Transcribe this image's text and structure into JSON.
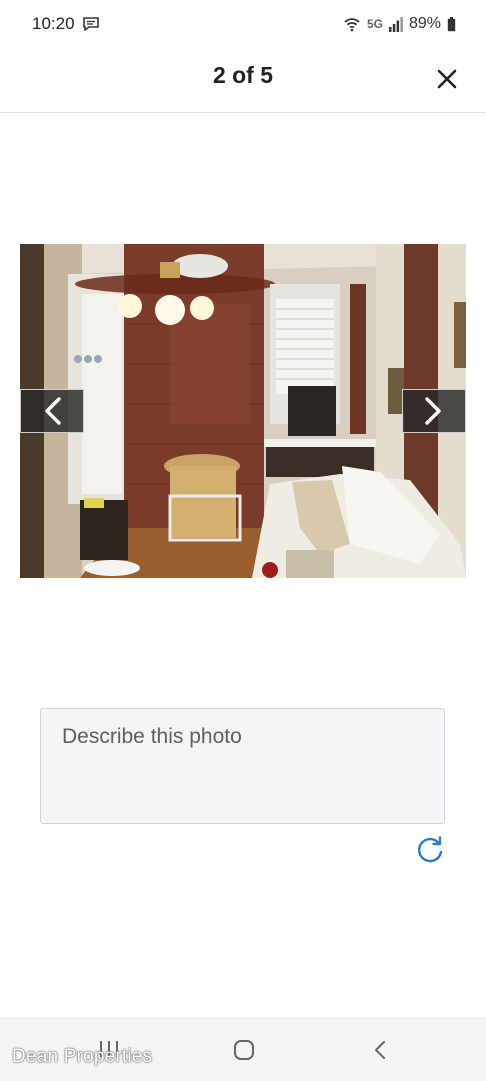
{
  "status_bar": {
    "time": "10:20",
    "network": "5G",
    "battery": "89%"
  },
  "header": {
    "counter": "2 of 5",
    "close_icon": "close-icon"
  },
  "gallery": {
    "prev_icon": "chevron-left-icon",
    "next_icon": "chevron-right-icon"
  },
  "description": {
    "placeholder": "Describe this photo",
    "value": ""
  },
  "actions": {
    "refresh_icon": "refresh-icon",
    "accent_color": "#2d7bc4"
  },
  "watermark": "Dean Properties"
}
